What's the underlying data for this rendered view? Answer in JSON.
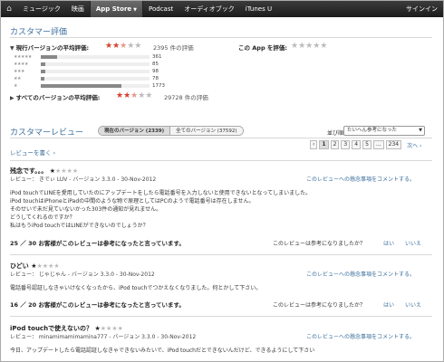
{
  "nav": {
    "home_icon": "home-icon",
    "items": [
      "ミュージック",
      "映画",
      "App Store",
      "Podcast",
      "オーディオブック",
      "iTunes U"
    ],
    "active_index": 2,
    "signin": "サインイン"
  },
  "ratings": {
    "title": "カスタマー評価",
    "current_label": "現行バージョンの平均評価:",
    "current_count": "2395 件の評価",
    "current_stars": 2.5,
    "rate_label": "この App を評価:",
    "histogram": [
      {
        "stars": 5,
        "count": "361",
        "fraction": 0.15
      },
      {
        "stars": 4,
        "count": "85",
        "fraction": 0.04
      },
      {
        "stars": 3,
        "count": "98",
        "fraction": 0.04
      },
      {
        "stars": 2,
        "count": "78",
        "fraction": 0.035
      },
      {
        "stars": 1,
        "count": "1773",
        "fraction": 0.74
      }
    ],
    "all_label": "すべてのバージョンの平均評価:",
    "all_count": "29728 件の評価",
    "all_stars": 2.5
  },
  "reviews_header": {
    "title": "カスタマーレビュー",
    "tab_current": "現在のバージョン (2339)",
    "tab_all": "全てのバージョン (37592)",
    "sort_label": "並び順:",
    "sort_value": "たいへん参考になった",
    "write": "レビューを書く ›",
    "pages": [
      "‹",
      "1",
      "2",
      "3",
      "4",
      "5",
      "...",
      "234"
    ],
    "current_page": "1",
    "next": "次へ ›"
  },
  "reviews": [
    {
      "title": "残念です。。。",
      "stars": 1,
      "meta": "レビュー： きでぃ LUV - バージョン 3.3.0 - 30-Nov-2012",
      "flag": "このレビューへの懸念事項をコメントする。",
      "body": [
        "iPod touchでLINEを愛用していたのにアップデートをしたら電話番号を入力しないと使用できないとなってしまいました。",
        "iPod touchはiPhoneとiPadの中間のような物で原理としてはPCのようで電話番号は存在しません。",
        "そのせいで未だ見ていないかった303件の通知が見れません。",
        "どうしてくれるのですか？",
        "私はもうiPod touchではLINEができないのでしょうか？"
      ],
      "helpful": "25 ／ 30 お客様がこのレビューは参考になったと言っています。",
      "question": "このレビューは参考になりましたか？",
      "yes": "はい",
      "no": "いいえ"
    },
    {
      "title": "ひどい",
      "stars": 1,
      "meta": "レビュー： じゃじゃん - バージョン 3.3.0 - 30-Nov-2012",
      "flag": "このレビューへの懸念事項をコメントする。",
      "body": [
        "電話番号認証しなきゃいけなくなったから、iPod touchでつかえなくなりました。何とかして下さい。"
      ],
      "helpful": "16 ／ 20 お客様がこのレビューは参考になったと言っています。",
      "question": "このレビューは参考になりましたか？",
      "yes": "はい",
      "no": "いいえ"
    },
    {
      "title": "iPod touchで使えないの？",
      "stars": 1,
      "meta": "レビュー： minamimamimamina777 - バージョン 3.3.0 - 30-Nov-2012",
      "flag": "このレビューへの懸念事項をコメントする。",
      "body": [
        "今日、アップデートしたら電話認証しなきゃできないみたいで、iPod touchだとできないんだけど、できるようにして下さい"
      ]
    }
  ]
}
